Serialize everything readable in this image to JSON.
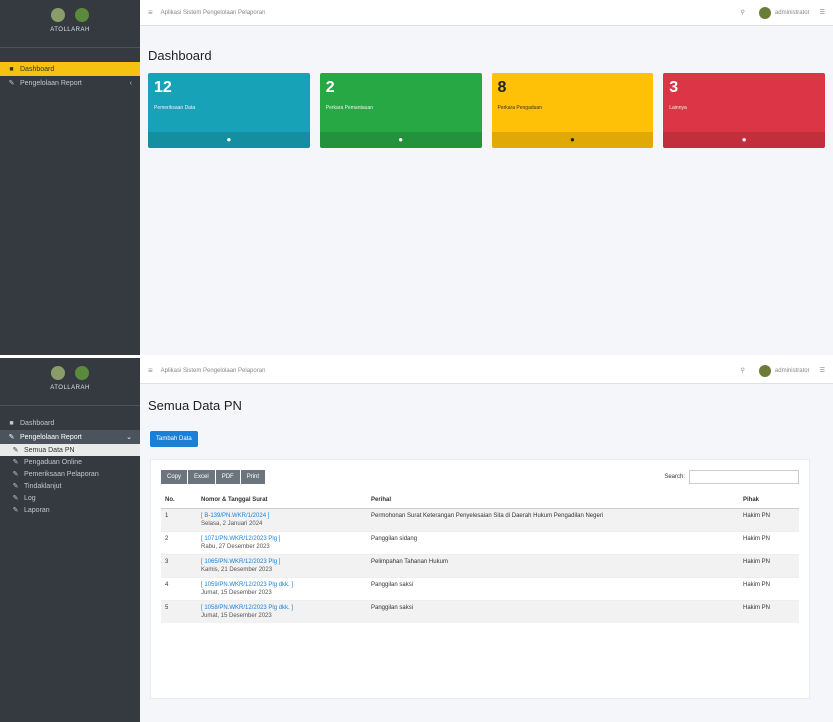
{
  "app": {
    "name": "ATOLLARAH",
    "topbar_title": "Aplikasi Sistem Pengelolaan Pelaporan",
    "user_name": "administrator"
  },
  "colors": {
    "sidebar": "#343a40",
    "active_nav": "#f5c211",
    "info": "#17a2b8",
    "success": "#28a745",
    "warning": "#ffc107",
    "danger": "#dc3545",
    "primary": "#1a7fd6"
  },
  "dashboard": {
    "sidebar": [
      {
        "label": "Dashboard",
        "icon": "dashboard-icon",
        "active": true
      },
      {
        "label": "Pengelolaan Report",
        "icon": "wrench-icon",
        "active": false
      }
    ],
    "title": "Dashboard",
    "boxes": [
      {
        "value": "12",
        "label": "Pemeriksaan Data",
        "color": "#17a2b8"
      },
      {
        "value": "2",
        "label": "Perkara Pemantauan",
        "color": "#28a745"
      },
      {
        "value": "8",
        "label": "Perkara Pengaduan",
        "color": "#ffc107"
      },
      {
        "value": "3",
        "label": "Lainnya",
        "color": "#dc3545"
      }
    ]
  },
  "pn": {
    "sidebar": [
      {
        "label": "Dashboard",
        "icon": "dashboard-icon"
      },
      {
        "label": "Pengelolaan Report",
        "icon": "wrench-icon"
      },
      {
        "label": "Semua Data PN",
        "icon": "edit-icon"
      },
      {
        "label": "Pengaduan Online",
        "icon": "edit-icon"
      },
      {
        "label": "Pemeriksaan Pelaporan",
        "icon": "edit-icon"
      },
      {
        "label": "Tindaklanjut",
        "icon": "edit-icon"
      },
      {
        "label": "Log",
        "icon": "edit-icon"
      },
      {
        "label": "Laporan",
        "icon": "edit-icon"
      }
    ],
    "title": "Semua Data PN",
    "add_button": "Tambah Data",
    "export_buttons": [
      "Copy",
      "Excel",
      "PDF",
      "Print"
    ],
    "search_label": "Search:",
    "columns": [
      "No.",
      "Nomor & Tanggal Surat",
      "Perihal",
      "Pihak"
    ],
    "rows": [
      {
        "no": "1",
        "nomor": "[ B-139/PN.WKR/1/2024 ]",
        "tanggal": "Selasa, 2 Januari 2024",
        "perihal": "Permohonan Surat Keterangan Penyelesaian Sita di Daerah Hukum Pengadilan Negeri",
        "pihak": "Hakim PN"
      },
      {
        "no": "2",
        "nomor": "[ 1071/PN.WKR/12/2023 Plg ]",
        "tanggal": "Rabu, 27 Desember 2023",
        "perihal": "Panggilan sidang",
        "pihak": "Hakim PN"
      },
      {
        "no": "3",
        "nomor": "[ 1065/PN.WKR/12/2023 Plg ]",
        "tanggal": "Kamis, 21 Desember 2023",
        "perihal": "Pelimpahan Tahanan Hukum",
        "pihak": "Hakim PN"
      },
      {
        "no": "4",
        "nomor": "[ 1059/PN.WKR/12/2023 Plg dkk. ]",
        "tanggal": "Jumat, 15 Desember 2023",
        "perihal": "Panggilan saksi",
        "pihak": "Hakim PN"
      },
      {
        "no": "5",
        "nomor": "[ 1058/PN.WKR/12/2023 Plg dkk. ]",
        "tanggal": "Jumat, 15 Desember 2023",
        "perihal": "Panggilan saksi",
        "pihak": "Hakim PN"
      }
    ]
  }
}
